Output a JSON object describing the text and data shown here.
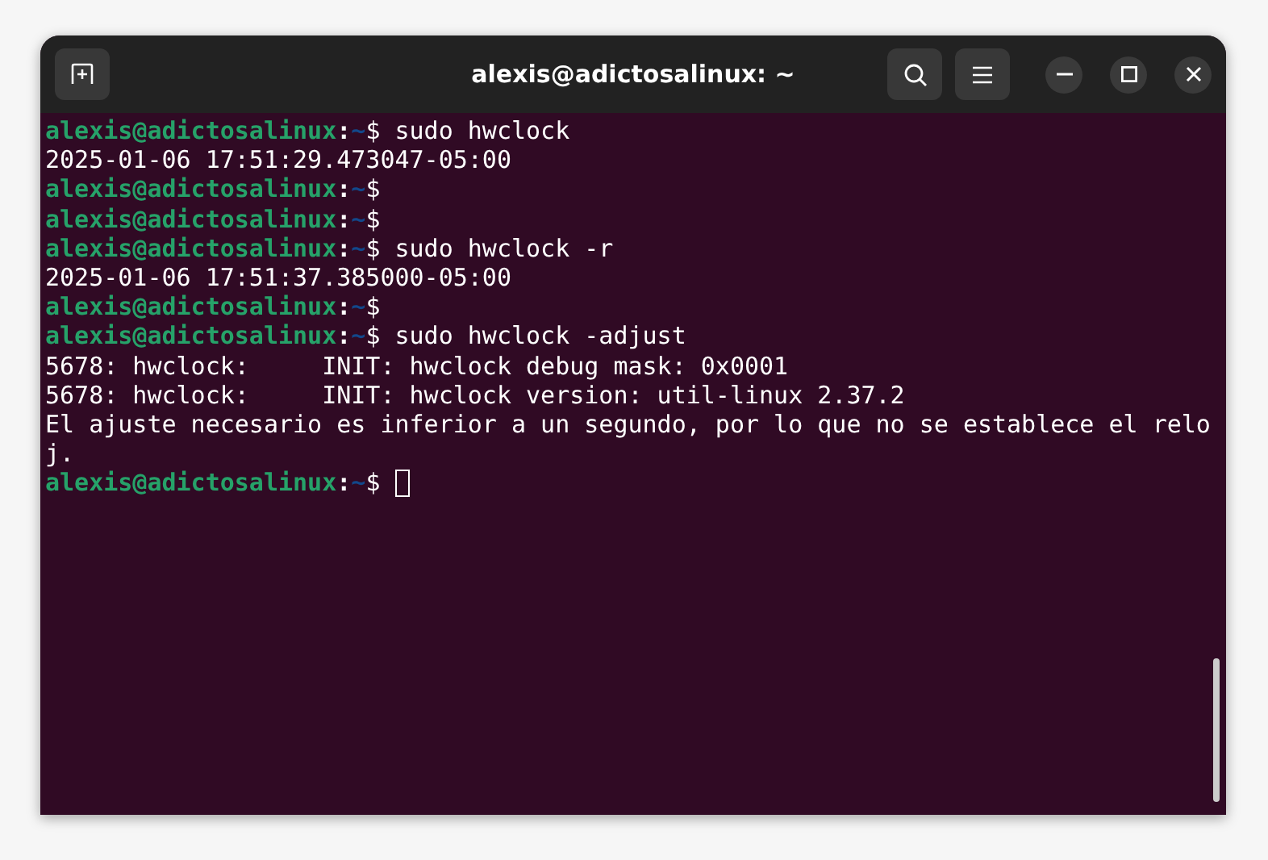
{
  "window": {
    "title": "alexis@adictosalinux: ~"
  },
  "lines": [
    {
      "kind": "prompt",
      "user": "alexis@adictosalinux",
      "separator": ":",
      "path": "~",
      "command": "$ sudo hwclock",
      "cursor": false
    },
    {
      "kind": "output",
      "text": "2025-01-06 17:51:29.473047-05:00",
      "cursor": false
    },
    {
      "kind": "prompt",
      "user": "alexis@adictosalinux",
      "separator": ":",
      "path": "~",
      "command": "$",
      "cursor": false
    },
    {
      "kind": "prompt",
      "user": "alexis@adictosalinux",
      "separator": ":",
      "path": "~",
      "command": "$",
      "cursor": false
    },
    {
      "kind": "prompt",
      "user": "alexis@adictosalinux",
      "separator": ":",
      "path": "~",
      "command": "$ sudo hwclock -r",
      "cursor": false
    },
    {
      "kind": "output",
      "text": "2025-01-06 17:51:37.385000-05:00",
      "cursor": false
    },
    {
      "kind": "prompt",
      "user": "alexis@adictosalinux",
      "separator": ":",
      "path": "~",
      "command": "$",
      "cursor": false
    },
    {
      "kind": "prompt",
      "user": "alexis@adictosalinux",
      "separator": ":",
      "path": "~",
      "command": "$ sudo hwclock -adjust",
      "cursor": false
    },
    {
      "kind": "output",
      "text": "5678: hwclock:     INIT: hwclock debug mask: 0x0001",
      "cursor": false
    },
    {
      "kind": "output",
      "text": "5678: hwclock:     INIT: hwclock version: util-linux 2.37.2",
      "cursor": false
    },
    {
      "kind": "output",
      "text": "El ajuste necesario es inferior a un segundo, por lo que no se establece el relo",
      "cursor": false
    },
    {
      "kind": "output",
      "text": "j.",
      "cursor": false
    },
    {
      "kind": "prompt",
      "user": "alexis@adictosalinux",
      "separator": ":",
      "path": "~",
      "command": "$",
      "cursor": true
    }
  ]
}
